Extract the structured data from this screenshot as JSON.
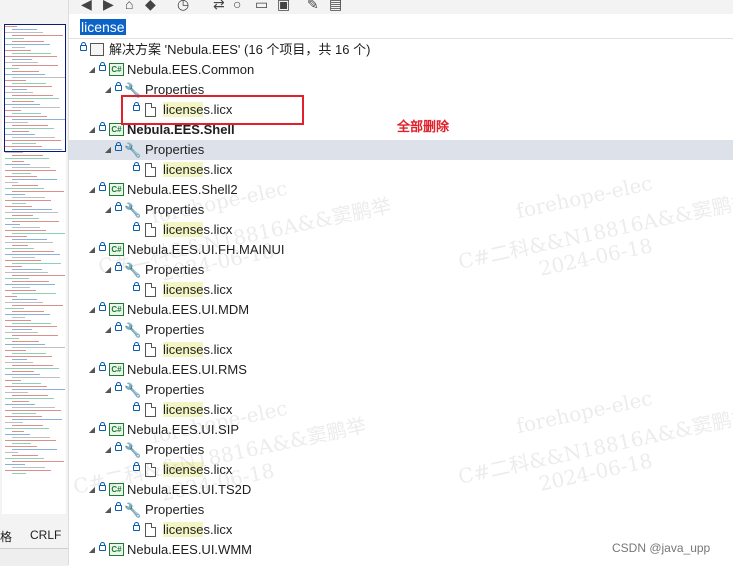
{
  "search": {
    "query": "license"
  },
  "solution": {
    "label": "解决方案 'Nebula.EES' (16 个项目，共 16 个)"
  },
  "annotation": {
    "text": "全部删除"
  },
  "status": {
    "encoding_fragment": "格",
    "line_ending": "CRLF"
  },
  "credit": "CSDN @java_upp",
  "watermark": {
    "company": "forehope-elec",
    "id": "C#二科&&N18816A&&窦鹏举",
    "date": "2024-06-18"
  },
  "tree": [
    {
      "kind": "project",
      "label": "Nebula.EES.Common",
      "bold": false
    },
    {
      "kind": "properties",
      "label": "Properties"
    },
    {
      "kind": "file",
      "label_hl": "license",
      "label_rest": "s.licx"
    },
    {
      "kind": "project",
      "label": "Nebula.EES.Shell",
      "bold": true
    },
    {
      "kind": "properties",
      "label": "Properties",
      "selected": true
    },
    {
      "kind": "file",
      "label_hl": "license",
      "label_rest": "s.licx"
    },
    {
      "kind": "project",
      "label": "Nebula.EES.Shell2",
      "bold": false
    },
    {
      "kind": "properties",
      "label": "Properties"
    },
    {
      "kind": "file",
      "label_hl": "license",
      "label_rest": "s.licx"
    },
    {
      "kind": "project",
      "label": "Nebula.EES.UI.FH.MAINUI",
      "bold": false
    },
    {
      "kind": "properties",
      "label": "Properties"
    },
    {
      "kind": "file",
      "label_hl": "license",
      "label_rest": "s.licx"
    },
    {
      "kind": "project",
      "label": "Nebula.EES.UI.MDM",
      "bold": false
    },
    {
      "kind": "properties",
      "label": "Properties"
    },
    {
      "kind": "file",
      "label_hl": "license",
      "label_rest": "s.licx"
    },
    {
      "kind": "project",
      "label": "Nebula.EES.UI.RMS",
      "bold": false
    },
    {
      "kind": "properties",
      "label": "Properties"
    },
    {
      "kind": "file",
      "label_hl": "license",
      "label_rest": "s.licx"
    },
    {
      "kind": "project",
      "label": "Nebula.EES.UI.SIP",
      "bold": false
    },
    {
      "kind": "properties",
      "label": "Properties"
    },
    {
      "kind": "file",
      "label_hl": "license",
      "label_rest": "s.licx"
    },
    {
      "kind": "project",
      "label": "Nebula.EES.UI.TS2D",
      "bold": false
    },
    {
      "kind": "properties",
      "label": "Properties"
    },
    {
      "kind": "file",
      "label_hl": "license",
      "label_rest": "s.licx"
    },
    {
      "kind": "project",
      "label": "Nebula.EES.UI.WMM",
      "bold": false
    }
  ]
}
